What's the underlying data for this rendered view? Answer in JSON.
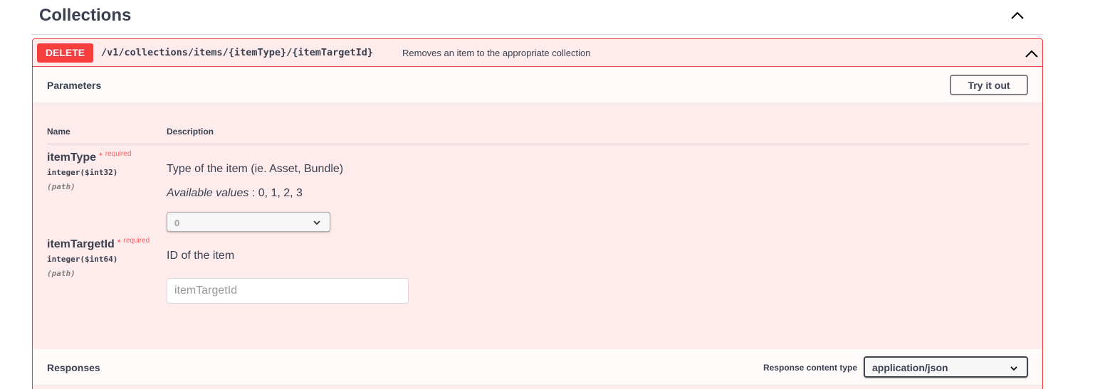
{
  "section": {
    "title": "Collections"
  },
  "operation": {
    "method": "DELETE",
    "path": "/v1/collections/items/{itemType}/{itemTargetId}",
    "summary": "Removes an item to the appropriate collection",
    "method_color": "#f93e3e"
  },
  "parameters": {
    "title": "Parameters",
    "try_label": "Try it out",
    "col_name": "Name",
    "col_description": "Description",
    "items": [
      {
        "name": "itemType",
        "required_star": "*",
        "required_label": "required",
        "type": "integer($int32)",
        "in": "(path)",
        "description": "Type of the item (ie. Asset, Bundle)",
        "available_label": "Available values",
        "available_values": ": 0, 1, 2, 3",
        "selected_value": "0"
      },
      {
        "name": "itemTargetId",
        "required_star": "*",
        "required_label": "required",
        "type": "integer($int64)",
        "in": "(path)",
        "description": "ID of the item",
        "placeholder": "itemTargetId"
      }
    ]
  },
  "responses": {
    "title": "Responses",
    "content_type_label": "Response content type",
    "content_type_value": "application/json"
  },
  "icons": {
    "section_toggle": "chevron-up-icon",
    "summary_toggle": "chevron-up-icon",
    "select_arrow": "chevron-down-icon"
  }
}
